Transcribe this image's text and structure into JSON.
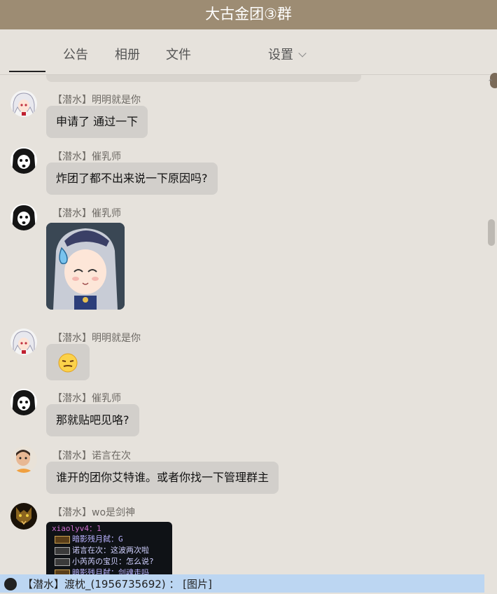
{
  "window": {
    "title": "大古金团③群"
  },
  "tabs": [
    {
      "label": ""
    },
    {
      "label": "公告"
    },
    {
      "label": "相册"
    },
    {
      "label": "文件"
    },
    {
      "label": "设置"
    }
  ],
  "messages": [
    {
      "sender": "【潜水】明明就是你",
      "text": "申请了 通过一下",
      "avatar": "anime-white-hair-avatar"
    },
    {
      "sender": "【潜水】催乳师",
      "text": "炸团了都不出来说一下原因吗?",
      "avatar": "anime-black-hair-avatar"
    },
    {
      "sender": "【潜水】催乳师",
      "image": "anime-girl-sweat-sticker",
      "avatar": "anime-black-hair-avatar"
    },
    {
      "sender": "【潜水】明明就是你",
      "emoji": "smirk-emoji",
      "avatar": "anime-white-hair-avatar"
    },
    {
      "sender": "【潜水】催乳师",
      "text": "那就贴吧见咯?",
      "avatar": "anime-black-hair-avatar"
    },
    {
      "sender": "【潜水】诺言在次",
      "text": "谁开的团你艾特谁。或者你找一下管理群主",
      "avatar": "child-photo-avatar"
    },
    {
      "sender": "【潜水】wo是剑神",
      "image": "game-chat-screenshot",
      "avatar": "wolf-avatar"
    }
  ],
  "game_screenshot": {
    "lines": [
      {
        "text": "xiaolyv4：1",
        "color": "#d070d0",
        "tag": ""
      },
      {
        "text": "暗影残月弑：G",
        "color": "#b9b2ff",
        "tag": "box"
      },
      {
        "text": "诺言在次：这波两次啦",
        "color": "#d0d0ff",
        "tag": "单人"
      },
      {
        "text": "小芮芮の宝贝：怎么说?",
        "color": "#d0d0ff",
        "tag": "单人"
      },
      {
        "text": "暗影残月弑：剑魂走吗",
        "color": "#b9b2ff",
        "tag": "box"
      }
    ]
  },
  "notification": {
    "text": "【潜水】渡枕_(1956735692) ： [图片]"
  },
  "colors": {
    "titlebar": "#9d8c73",
    "background": "#e6e2dc",
    "bubble": "#d2cfcb",
    "notification": "#bcd6f2"
  }
}
